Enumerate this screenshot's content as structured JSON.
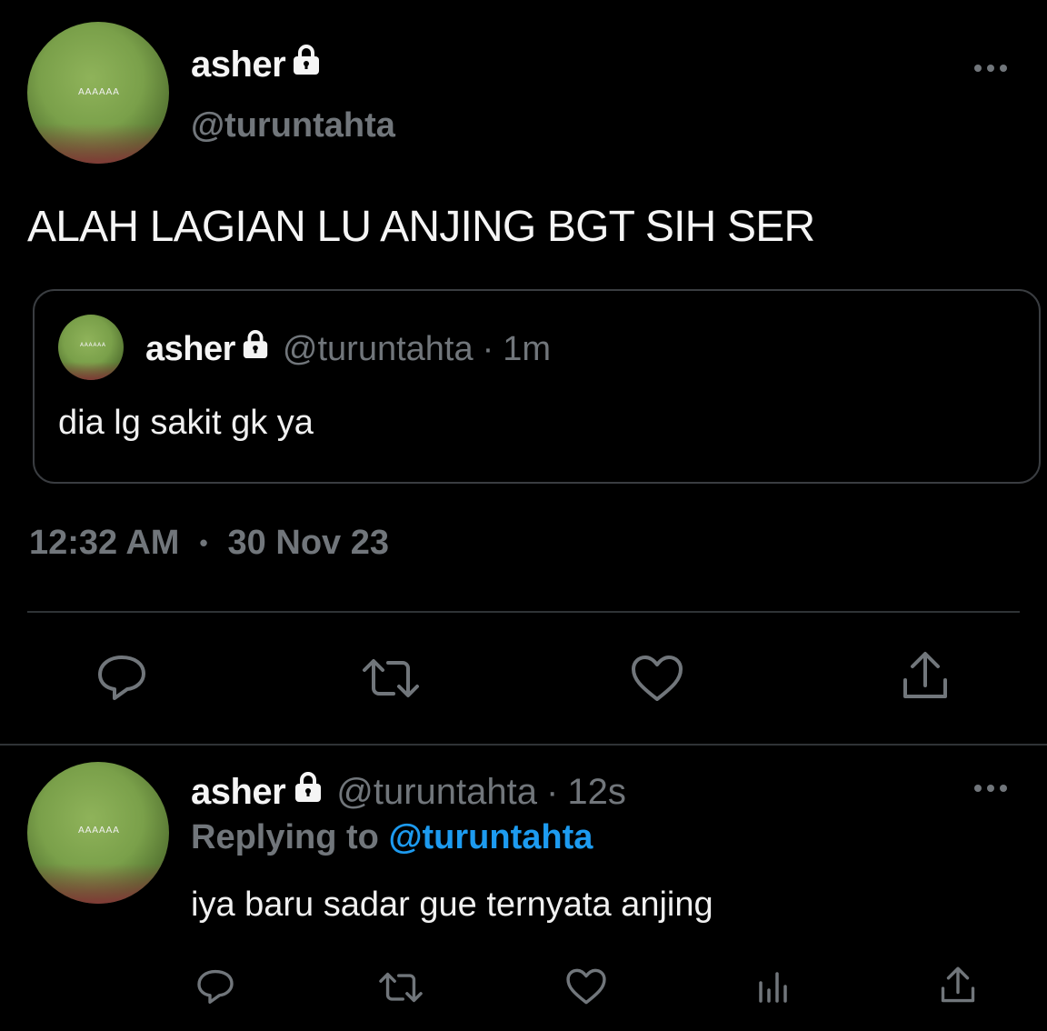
{
  "main_tweet": {
    "avatar_text": "AAAAAA",
    "display_name": "asher",
    "handle": "@turuntahta",
    "text": "ALAH LAGIAN LU ANJING BGT SIH SER",
    "time": "12:32 AM",
    "separator": "•",
    "date": "30 Nov 23"
  },
  "quoted_tweet": {
    "avatar_text": "AAAAAA",
    "display_name": "asher",
    "handle": "@turuntahta",
    "dot": "·",
    "age": "1m",
    "text": "dia lg sakit gk ya"
  },
  "reply_tweet": {
    "avatar_text": "AAAAAA",
    "display_name": "asher",
    "handle": "@turuntahta",
    "dot": "·",
    "age": "12s",
    "replying_label": "Replying to",
    "replying_handle": "@turuntahta",
    "text": "iya baru sadar gue ternyata anjing"
  },
  "icons": {
    "more": "more-horizontal-icon",
    "lock": "lock-icon",
    "reply": "reply-icon",
    "retweet": "retweet-icon",
    "like": "heart-icon",
    "views": "views-icon",
    "share": "share-icon"
  },
  "colors": {
    "background": "#000000",
    "text": "#e7e9ea",
    "muted": "#71767b",
    "link": "#1d9bf0",
    "divider": "#2f3336"
  }
}
